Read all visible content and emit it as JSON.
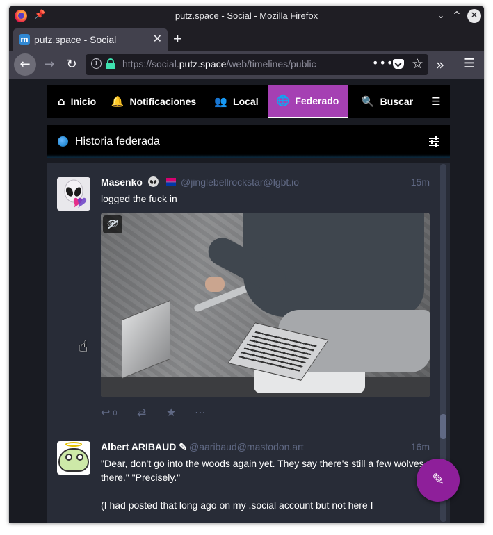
{
  "window": {
    "title": "putz.space - Social - Mozilla Firefox",
    "minimize": "⌄",
    "maximize": "^",
    "close": "✕"
  },
  "tabs": [
    {
      "title": "putz.space - Social",
      "favicon": "mastodon-icon"
    }
  ],
  "newtab": "+",
  "navbar": {
    "url_prefix": "https://social.",
    "url_domain": "putz.space",
    "url_path": "/web/timelines/public",
    "page_actions": "•••"
  },
  "mastodon_tabs": [
    {
      "label": "Inicio",
      "icon": "home-icon"
    },
    {
      "label": "Notificaciones",
      "icon": "bell-icon"
    },
    {
      "label": "Local",
      "icon": "users-icon"
    },
    {
      "label": "Federado",
      "icon": "globe-icon",
      "active": true
    },
    {
      "label": "Buscar",
      "icon": "search-icon"
    }
  ],
  "column": {
    "title": "Historia federada"
  },
  "statuses": [
    {
      "display_name": "Masenko",
      "handle": "@jinglebellrockstar@lgbt.io",
      "time": "15m",
      "content": "logged the fuck in",
      "reply_count": "0",
      "media": {
        "hidden_toggle": "eye-slash-icon"
      }
    },
    {
      "display_name": "Albert ARIBAUD",
      "name_suffix": "✎",
      "handle": "@aaribaud@mastodon.art",
      "time": "16m",
      "content_p1": "\"Dear, don't go into the woods again yet. They say there's still a few wolves there.\" \"Precisely.\"",
      "content_p2": "(I had posted that long ago on my .social account but not here I"
    }
  ],
  "colors": {
    "accent": "#a540b3",
    "compose": "#8e1f9a",
    "timeline_bg": "#282c37",
    "muted_text": "#606984"
  }
}
